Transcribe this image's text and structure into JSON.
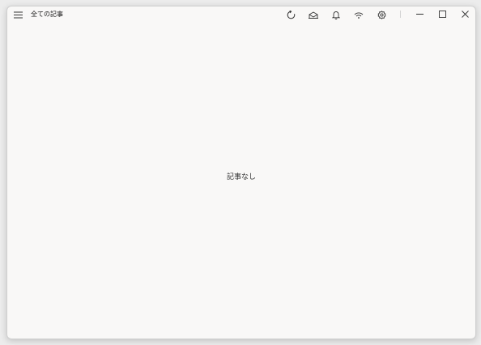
{
  "window": {
    "title": "全ての記事"
  },
  "toolbar": {
    "icons": [
      {
        "name": "hamburger-menu-icon"
      },
      {
        "name": "refresh-icon"
      },
      {
        "name": "mark-all-read-icon"
      },
      {
        "name": "notification-bell-icon"
      },
      {
        "name": "feed-signal-icon"
      },
      {
        "name": "gear-icon"
      }
    ]
  },
  "window_controls": {
    "minimize": "minimize-icon",
    "maximize": "maximize-icon",
    "close": "close-icon"
  },
  "main": {
    "empty_message": "記事なし"
  },
  "colors": {
    "window_background": "#f9f8f7",
    "text": "#1a1a1a",
    "icon": "#333333"
  }
}
